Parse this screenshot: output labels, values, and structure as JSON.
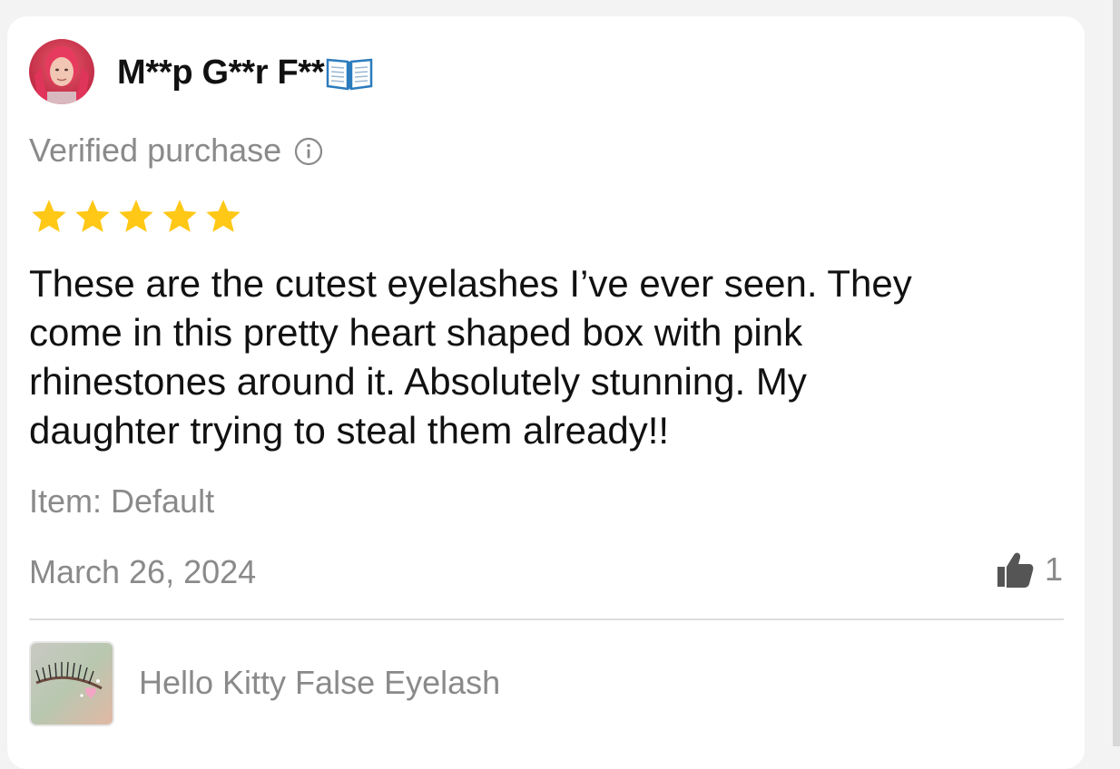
{
  "review": {
    "reviewer_name": "M**p G**r F**",
    "reviewer_emoji_icon": "open-book-icon",
    "verified_label": "Verified purchase",
    "info_icon": "info-icon",
    "rating": 5,
    "rating_max": 5,
    "star_color": "#FFC816",
    "text": "These are the cutest eyelashes I’ve ever seen. They\ncome in this pretty heart shaped box with pink\nrhinestones around it. Absolutely stunning. My\ndaughter trying to steal them already!!",
    "item_label": "Item: Default",
    "date": "March 26, 2024",
    "like_icon": "thumbs-up-icon",
    "like_count": "1"
  },
  "product": {
    "name": "Hello Kitty False Eyelash",
    "thumbnail_icon": "eyelash-product-thumbnail"
  },
  "colors": {
    "primary_text": "#111111",
    "secondary_text": "#8A8A8A",
    "card_background": "#FFFFFF",
    "page_background": "#F3F3F3"
  }
}
